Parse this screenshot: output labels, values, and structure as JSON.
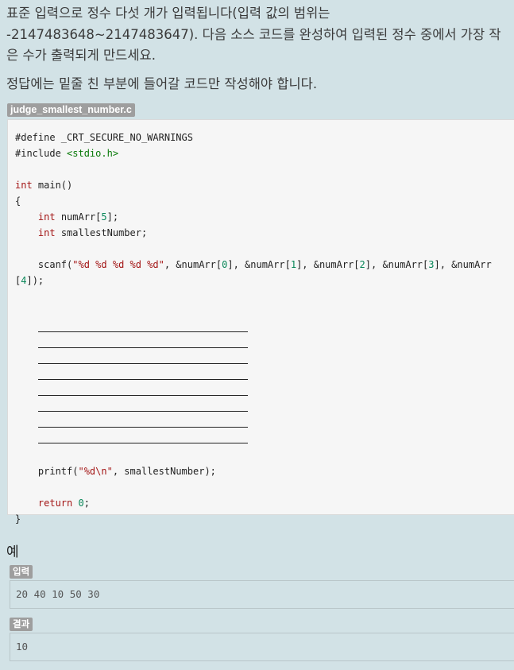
{
  "description": {
    "paragraph1_line1": "표준 입력으로 정수 다섯 개가 입력됩니다(입력 값의 범위는",
    "paragraph1_line2": "-2147483648~2147483647). 다음 소스 코드를 완성하여 입력된 정수 중에서 가장 작",
    "paragraph1_line3": "은 수가 출력되게 만드세요.",
    "paragraph2": "정답에는 밑줄 친 부분에 들어갈 코드만 작성해야 합니다."
  },
  "code_file": {
    "filename": "judge_smallest_number.c",
    "lines": {
      "l1": "#define _CRT_SECURE_NO_WARNINGS",
      "l2_kw": "#include ",
      "l2_hdr": "<stdio.h>",
      "l4_type": "int",
      "l4_rest": " main()",
      "l5": "{",
      "l6_type": "int",
      "l6_a": " numArr[",
      "l6_num": "5",
      "l6_b": "];",
      "l7_type": "int",
      "l7_rest": " smallestNumber;",
      "l9_a": "scanf(",
      "l9_str": "\"%d %d %d %d %d\"",
      "l9_b": ", &numArr[",
      "l9_n0": "0",
      "l9_c": "], &numArr[",
      "l9_n1": "1",
      "l9_d": "], &numArr[",
      "l9_n2": "2",
      "l9_e": "], &numArr[",
      "l9_n3": "3",
      "l9_f": "], &numArr",
      "l10_a": "[",
      "l10_n4": "4",
      "l10_b": "]);",
      "l20_a": "printf(",
      "l20_str": "\"%d\\n\"",
      "l20_b": ", smallestNumber);",
      "l22_kw": "return",
      "l22_num": "0",
      "l22_b": ";",
      "l23": "}"
    },
    "blank_count": 8
  },
  "example": {
    "title": "예",
    "input_label": "입력",
    "input_value": "20 40 10 50 30",
    "output_label": "결과",
    "output_value": "10"
  }
}
